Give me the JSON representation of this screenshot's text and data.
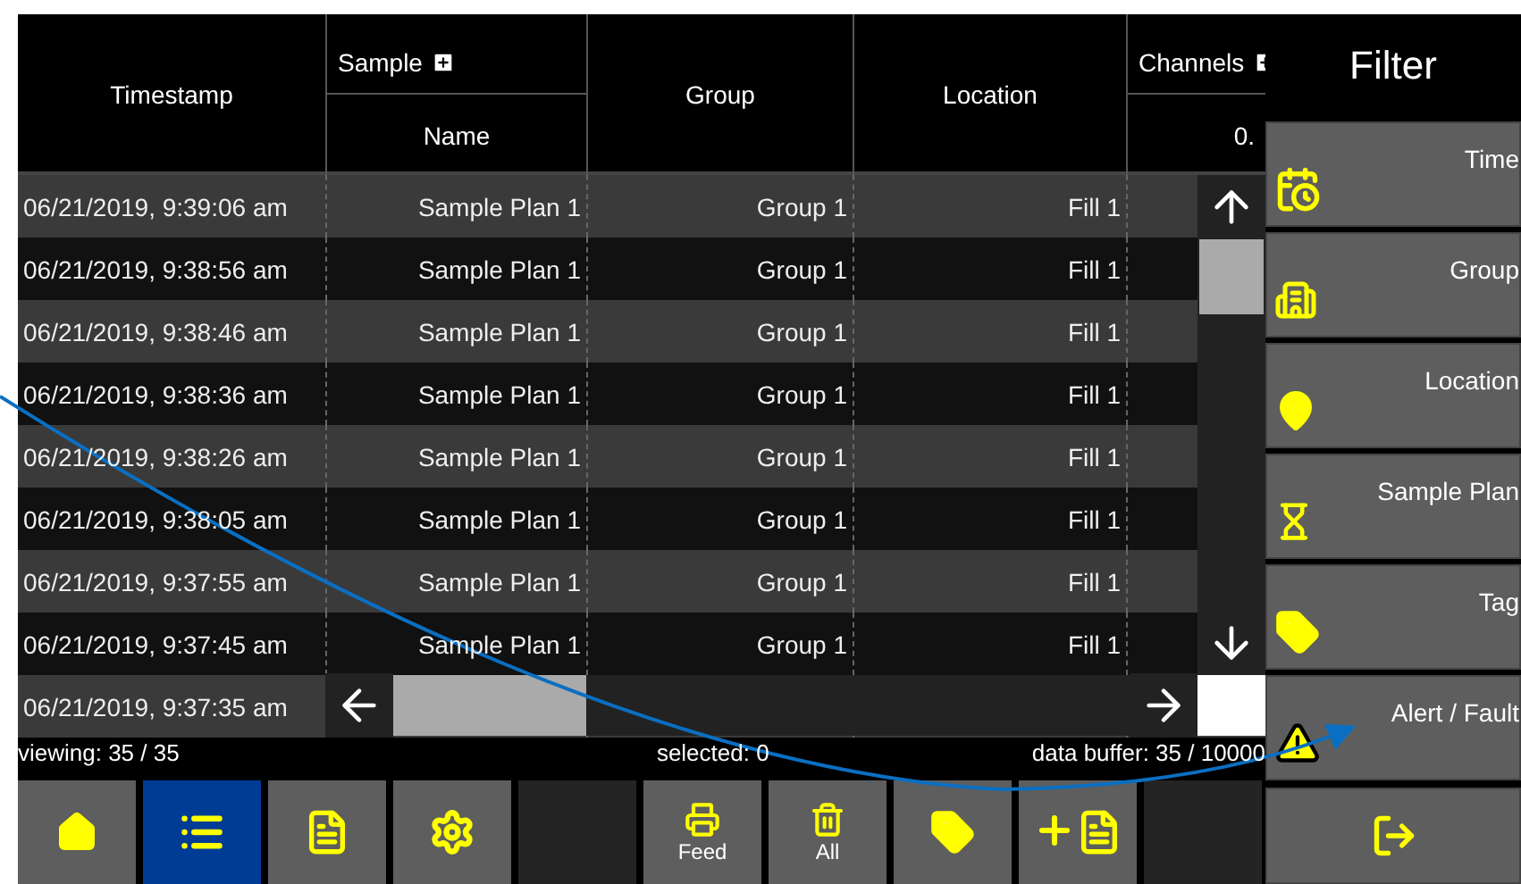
{
  "table": {
    "group_headers": [
      {
        "label": "Sample"
      },
      {
        "label": "Channels"
      }
    ],
    "columns": [
      {
        "label": "Timestamp"
      },
      {
        "label": "Name"
      },
      {
        "label": "Group"
      },
      {
        "label": "Location"
      },
      {
        "label": "0."
      }
    ],
    "rows": [
      {
        "timestamp": "06/21/2019, 9:39:06 am",
        "name": "Sample Plan 1",
        "group": "Group 1",
        "location": "Fill 1"
      },
      {
        "timestamp": "06/21/2019, 9:38:56 am",
        "name": "Sample Plan 1",
        "group": "Group 1",
        "location": "Fill 1"
      },
      {
        "timestamp": "06/21/2019, 9:38:46 am",
        "name": "Sample Plan 1",
        "group": "Group 1",
        "location": "Fill 1"
      },
      {
        "timestamp": "06/21/2019, 9:38:36 am",
        "name": "Sample Plan 1",
        "group": "Group 1",
        "location": "Fill 1"
      },
      {
        "timestamp": "06/21/2019, 9:38:26 am",
        "name": "Sample Plan 1",
        "group": "Group 1",
        "location": "Fill 1"
      },
      {
        "timestamp": "06/21/2019, 9:38:05 am",
        "name": "Sample Plan 1",
        "group": "Group 1",
        "location": "Fill 1"
      },
      {
        "timestamp": "06/21/2019, 9:37:55 am",
        "name": "Sample Plan 1",
        "group": "Group 1",
        "location": "Fill 1"
      },
      {
        "timestamp": "06/21/2019, 9:37:45 am",
        "name": "Sample Plan 1",
        "group": "Group 1",
        "location": "Fill 1"
      },
      {
        "timestamp": "06/21/2019, 9:37:35 am"
      }
    ]
  },
  "status_bar": {
    "viewing": "viewing: 35 / 35",
    "selected": "selected: 0",
    "buffer": "data buffer: 35 / 10000"
  },
  "toolbar": [
    {
      "kind": "home",
      "selected": false
    },
    {
      "kind": "list",
      "selected": true
    },
    {
      "kind": "document",
      "selected": false
    },
    {
      "kind": "settings",
      "selected": false
    },
    {
      "kind": "blank",
      "selected": false
    },
    {
      "kind": "printer",
      "label": "Feed",
      "selected": false
    },
    {
      "kind": "trash",
      "label": "All",
      "selected": false
    },
    {
      "kind": "tag",
      "selected": false
    },
    {
      "kind": "add-document",
      "selected": false
    },
    {
      "kind": "blank",
      "selected": false
    }
  ],
  "filter": {
    "title": "Filter",
    "items": [
      {
        "kind": "time",
        "label": "Time"
      },
      {
        "kind": "group",
        "label": "Group"
      },
      {
        "kind": "location",
        "label": "Location"
      },
      {
        "kind": "sample-plan",
        "label": "Sample Plan"
      },
      {
        "kind": "tag",
        "label": "Tag"
      },
      {
        "kind": "alert",
        "label": "Alert / Fault"
      }
    ],
    "exit": {
      "kind": "exit"
    }
  }
}
